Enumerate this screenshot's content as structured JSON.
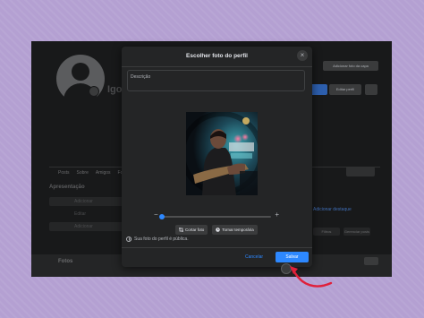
{
  "background_profile": {
    "name_partial": "Igo",
    "cover_button": "Adicionar foto da capa",
    "edit_button": "Editar perfil",
    "tabs": [
      "Posts",
      "Sobre",
      "Amigos",
      "Fotos"
    ],
    "intro_heading": "Apresentação",
    "intro_rows": [
      "Adicionar",
      "Editar",
      "Adicionar"
    ],
    "right_link": "Adicionar destaque",
    "right_buttons": [
      "Filtros",
      "Gerenciar posts"
    ],
    "photos_heading": "Fotos"
  },
  "modal": {
    "title": "Escolher foto do perfil",
    "close_icon": "close-icon",
    "description_placeholder": "Descrição",
    "zoom": {
      "minus": "−",
      "plus": "+",
      "level_fraction": 0.0
    },
    "crop_button": "Cortar foto",
    "temporary_button": "Tornar temporária",
    "public_notice": "Sua foto do perfil é pública.",
    "cancel_button": "Cancelar",
    "save_button": "Salvar"
  },
  "colors": {
    "accent": "#2d88ff",
    "annotation": "#e0203a",
    "outer_background": "#b4a0d2"
  }
}
